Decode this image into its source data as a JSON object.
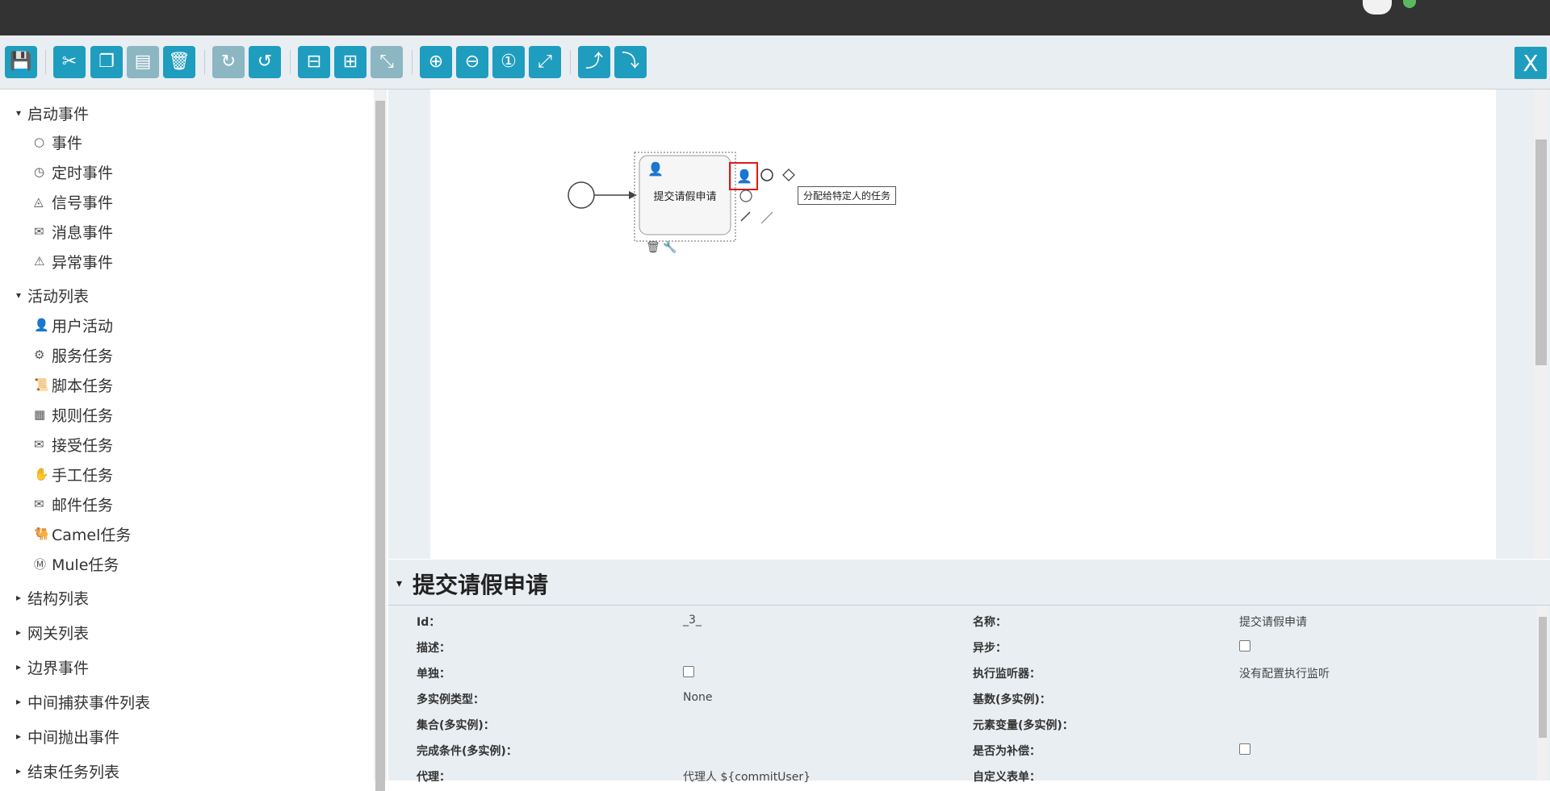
{
  "toolbar": {
    "icons": [
      "save-icon",
      "cut-icon",
      "copy-icon",
      "paste-icon",
      "delete-icon",
      "redo-icon",
      "undo-icon",
      "align-horizontal-icon",
      "align-vertical-icon",
      "same-size-icon",
      "zoom-in-icon",
      "zoom-out-icon",
      "zoom-actual-icon",
      "zoom-fit-icon",
      "bend-add-icon",
      "bend-remove-icon"
    ],
    "close_label": "X"
  },
  "sidebar": {
    "groups": [
      {
        "label": "启动事件",
        "expanded": true,
        "items": [
          {
            "label": "事件",
            "icon": "○"
          },
          {
            "label": "定时事件",
            "icon": "◷"
          },
          {
            "label": "信号事件",
            "icon": "◬"
          },
          {
            "label": "消息事件",
            "icon": "✉"
          },
          {
            "label": "异常事件",
            "icon": "⚠"
          }
        ]
      },
      {
        "label": "活动列表",
        "expanded": true,
        "items": [
          {
            "label": "用户活动",
            "icon": "👤"
          },
          {
            "label": "服务任务",
            "icon": "⚙"
          },
          {
            "label": "脚本任务",
            "icon": "📜"
          },
          {
            "label": "规则任务",
            "icon": "▦"
          },
          {
            "label": "接受任务",
            "icon": "✉"
          },
          {
            "label": "手工任务",
            "icon": "✋"
          },
          {
            "label": "邮件任务",
            "icon": "✉"
          },
          {
            "label": "Camel任务",
            "icon": "🐫"
          },
          {
            "label": "Mule任务",
            "icon": "Ⓜ"
          }
        ]
      },
      {
        "label": "结构列表",
        "expanded": false
      },
      {
        "label": "网关列表",
        "expanded": false
      },
      {
        "label": "边界事件",
        "expanded": false
      },
      {
        "label": "中间捕获事件列表",
        "expanded": false
      },
      {
        "label": "中间抛出事件",
        "expanded": false
      },
      {
        "label": "结束任务列表",
        "expanded": false
      }
    ]
  },
  "diagram": {
    "task_label": "提交请假申请",
    "tooltip": "分配给特定人的任务"
  },
  "props": {
    "title": "提交请假申请",
    "rows": [
      {
        "l1": "Id：",
        "v1": "_3_",
        "l2": "名称：",
        "v2": "提交请假申请"
      },
      {
        "l1": "描述：",
        "v1": "",
        "l2": "异步：",
        "v2": ""
      },
      {
        "l1": "单独：",
        "v1": "",
        "l2": "执行监听器：",
        "v2": "没有配置执行监听"
      },
      {
        "l1": "多实例类型：",
        "v1": "None",
        "l2": "基数(多实例)：",
        "v2": ""
      },
      {
        "l1": "集合(多实例)：",
        "v1": "",
        "l2": "元素变量(多实例)：",
        "v2": ""
      },
      {
        "l1": "完成条件(多实例)：",
        "v1": "",
        "l2": "是否为补偿：",
        "v2": ""
      },
      {
        "l1": "代理：",
        "v1": "代理人 ${commitUser}",
        "l2": "自定义表单：",
        "v2": ""
      }
    ]
  }
}
